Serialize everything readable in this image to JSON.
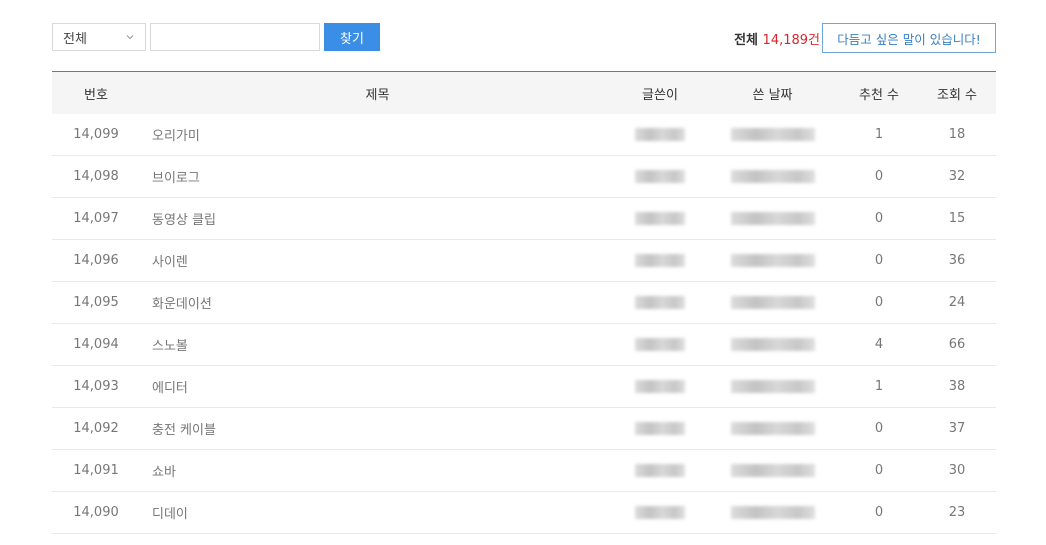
{
  "search": {
    "scope_value": "전체",
    "query_value": "",
    "button_label": "찾기"
  },
  "total": {
    "label": "전체",
    "count": "14,189건"
  },
  "write_button_label": "다듬고 싶은 말이 있습니다!",
  "colors": {
    "accent": "#3a8ee6",
    "count_red": "#d9262c",
    "write_border": "#6fa8d8"
  },
  "table": {
    "headers": {
      "number": "번호",
      "title": "제목",
      "author": "글쓴이",
      "date": "쓴 날짜",
      "recommend": "추천 수",
      "views": "조회 수"
    },
    "rows": [
      {
        "number": "14,099",
        "title": "오리가미",
        "recommend": "1",
        "views": "18"
      },
      {
        "number": "14,098",
        "title": "브이로그",
        "recommend": "0",
        "views": "32"
      },
      {
        "number": "14,097",
        "title": "동영상 클립",
        "recommend": "0",
        "views": "15"
      },
      {
        "number": "14,096",
        "title": "사이렌",
        "recommend": "0",
        "views": "36"
      },
      {
        "number": "14,095",
        "title": "화운데이션",
        "recommend": "0",
        "views": "24"
      },
      {
        "number": "14,094",
        "title": "스노볼",
        "recommend": "4",
        "views": "66"
      },
      {
        "number": "14,093",
        "title": "에디터",
        "recommend": "1",
        "views": "38"
      },
      {
        "number": "14,092",
        "title": "충전 케이블",
        "recommend": "0",
        "views": "37"
      },
      {
        "number": "14,091",
        "title": "쇼바",
        "recommend": "0",
        "views": "30"
      },
      {
        "number": "14,090",
        "title": "디데이",
        "recommend": "0",
        "views": "23"
      }
    ]
  }
}
